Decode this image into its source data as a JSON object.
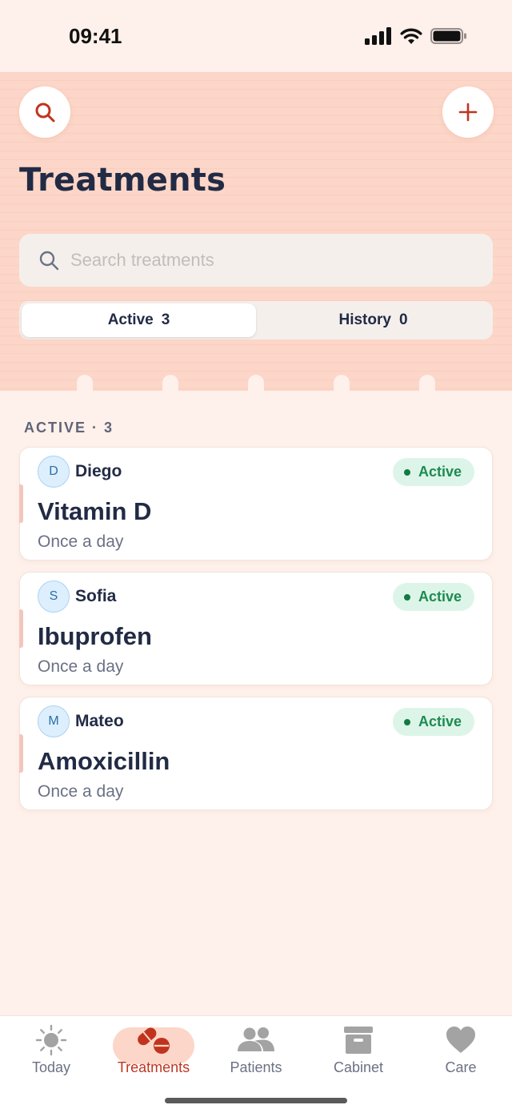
{
  "status_bar": {
    "time": "09:41"
  },
  "header": {
    "title": "Treatments",
    "search_placeholder": "Search treatments",
    "segments": [
      {
        "label": "Active",
        "count": "3",
        "selected": true
      },
      {
        "label": "History",
        "count": "0",
        "selected": false
      }
    ]
  },
  "section": {
    "label": "ACTIVE · 3"
  },
  "treatments": [
    {
      "avatar_initial": "D",
      "patient": "Diego",
      "status": "Active",
      "medication": "Vitamin D",
      "frequency": "Once a day"
    },
    {
      "avatar_initial": "S",
      "patient": "Sofia",
      "status": "Active",
      "medication": "Ibuprofen",
      "frequency": "Once a day"
    },
    {
      "avatar_initial": "M",
      "patient": "Mateo",
      "status": "Active",
      "medication": "Amoxicillin",
      "frequency": "Once a day"
    }
  ],
  "nav": {
    "items": [
      {
        "label": "Today",
        "icon": "sun-icon"
      },
      {
        "label": "Treatments",
        "icon": "pills-icon",
        "active": true
      },
      {
        "label": "Patients",
        "icon": "people-icon"
      },
      {
        "label": "Cabinet",
        "icon": "cabinet-icon"
      },
      {
        "label": "Care",
        "icon": "heart-icon"
      }
    ]
  },
  "colors": {
    "accent": "#C0341F",
    "header_bg": "#FCD6C8",
    "page_bg": "#FEF0EA",
    "status_active": "#1E8A52"
  }
}
